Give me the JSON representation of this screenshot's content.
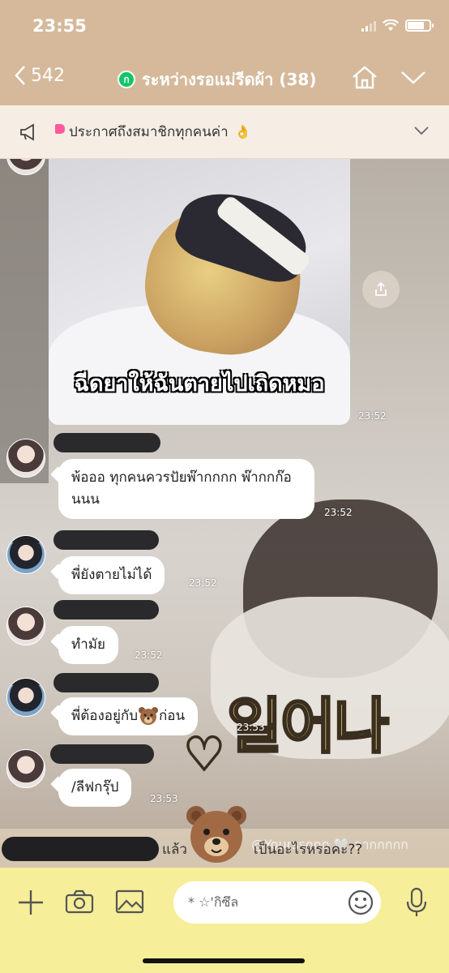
{
  "status_bar": {
    "time": "23:55"
  },
  "header": {
    "back_count": "542",
    "group_name": "ระหว่างรอแม่รีดผ้า (38)",
    "badge_letter": "ก"
  },
  "announcement": {
    "text": "ประกาศถึงสมาชิกทุกคนค่า",
    "emoji": "👌"
  },
  "background_text": {
    "korean": "일어나",
    "heart": "♡"
  },
  "messages": [
    {
      "type": "image",
      "caption": "ฉีดยาให้ฉันตายไปเถิดหมอ",
      "time": "23:52"
    },
    {
      "type": "text",
      "text": "พ้อออ ทุกคนควรปัยพ๊ากกกก พ๊ากกก๊อนนน",
      "time": "23:52"
    },
    {
      "type": "text",
      "text": "พี่ยังตายไม่ได้",
      "time": "23:52"
    },
    {
      "type": "text",
      "text": "ทำมัย",
      "time": "23:52"
    },
    {
      "type": "text",
      "text_before": "พี่ต้องอยู่กับ",
      "text_after": "ก่อน",
      "time": "23:53"
    },
    {
      "type": "text",
      "text": "/ลีฟกรุ๊ป",
      "time": "23:53"
    }
  ],
  "preview": {
    "text_before": "แล้ว",
    "text_after": "เป็นอะไรหรอคะ??",
    "ghost": "@Yourssono 🤍 ลากกกกก"
  },
  "input": {
    "placeholder": "* ☆'กิซึล"
  },
  "colors": {
    "header": "#d5b99a",
    "announce_bg": "#f6eee4",
    "input_bar": "#f6ee99",
    "line_green": "#13c566"
  }
}
